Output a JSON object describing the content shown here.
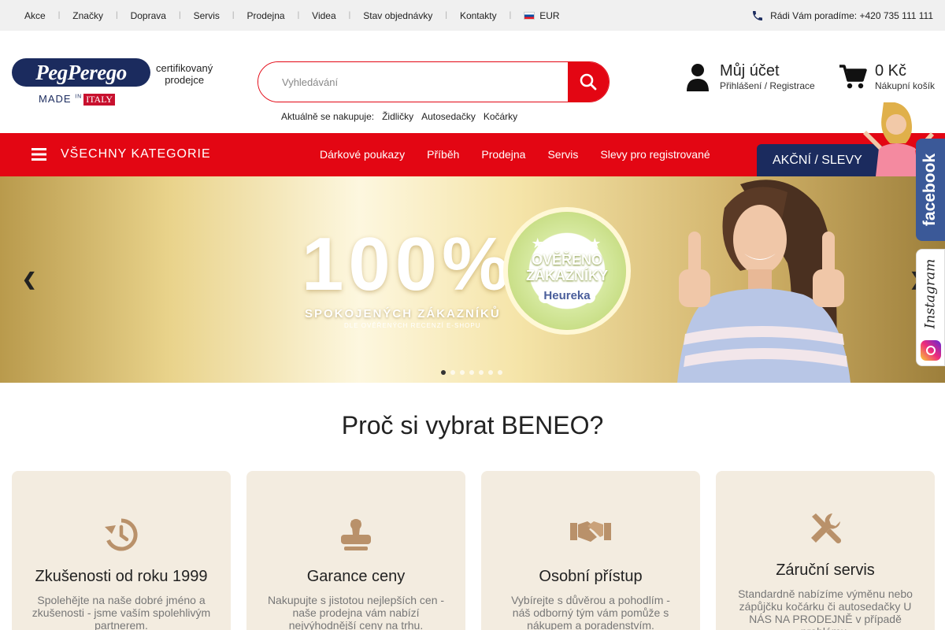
{
  "topbar": {
    "nav": [
      "Akce",
      "Značky",
      "Doprava",
      "Servis",
      "Prodejna",
      "Videa",
      "Stav objednávky",
      "Kontakty"
    ],
    "currency": "EUR",
    "phone": "Rádi Vám poradíme: +420 735 111 111"
  },
  "logo": {
    "brand": "PegPerego",
    "made": "MADE",
    "in": "IN",
    "italy": "ITALY",
    "certified": "certifikovaný\nprodejce"
  },
  "search": {
    "placeholder": "Vyhledávání",
    "trending_label": "Aktuálně se nakupuje:",
    "trending": [
      "Židličky",
      "Autosedačky",
      "Kočárky"
    ]
  },
  "account": {
    "title": "Můj účet",
    "subtitle": "Přihlášení / Registrace"
  },
  "cart": {
    "total": "0 Kč",
    "subtitle": "Nákupní košík"
  },
  "mainnav": {
    "all_categories": "VŠECHNY KATEGORIE",
    "links": [
      "Dárkové poukazy",
      "Příběh",
      "Prodejna",
      "Servis",
      "Slevy pro registrované"
    ],
    "promo": "AKČNÍ / SLEVY"
  },
  "hero": {
    "headline": "100%",
    "sub1": "SPOKOJENÝCH ZÁKAZNÍKŮ",
    "sub2": "DLE OVĚŘENÝCH RECENZÍ E-SHOPU",
    "badge_stars": "★★★★★",
    "badge_text": "OVĚŘENO\nZÁKAZNÍKY",
    "badge_brand": "Heureka",
    "slides": 7,
    "active_slide": 1
  },
  "social": {
    "facebook": "facebook",
    "instagram": "Instagram"
  },
  "why": {
    "title": "Proč si vybrat BENEO?",
    "cards": [
      {
        "icon": "history-icon",
        "title": "Zkušenosti od roku 1999",
        "text": "Spolehějte na naše dobré jméno a zkušenosti - jsme vaším spolehlivým partnerem."
      },
      {
        "icon": "stamp-icon",
        "title": "Garance ceny",
        "text": "Nakupujte s jistotou nejlepších cen - naše prodejna vám nabízí nejvýhodnější ceny na trhu."
      },
      {
        "icon": "handshake-icon",
        "title": "Osobní přístup",
        "text": "Vybírejte s důvěrou a pohodlím - náš odborný tým vám pomůže s nákupem a poradenstvím."
      },
      {
        "icon": "tools-icon",
        "title": "Záruční servis",
        "text": "Standardně nabízíme výměnu nebo zápůjčku kočárku či autosedačky U NÁS NA PRODEJNĚ v případě problému."
      }
    ]
  },
  "colors": {
    "red": "#e30613",
    "navy": "#1b2b5e",
    "card_bg": "#f3ece0",
    "icon": "#b9916a"
  }
}
